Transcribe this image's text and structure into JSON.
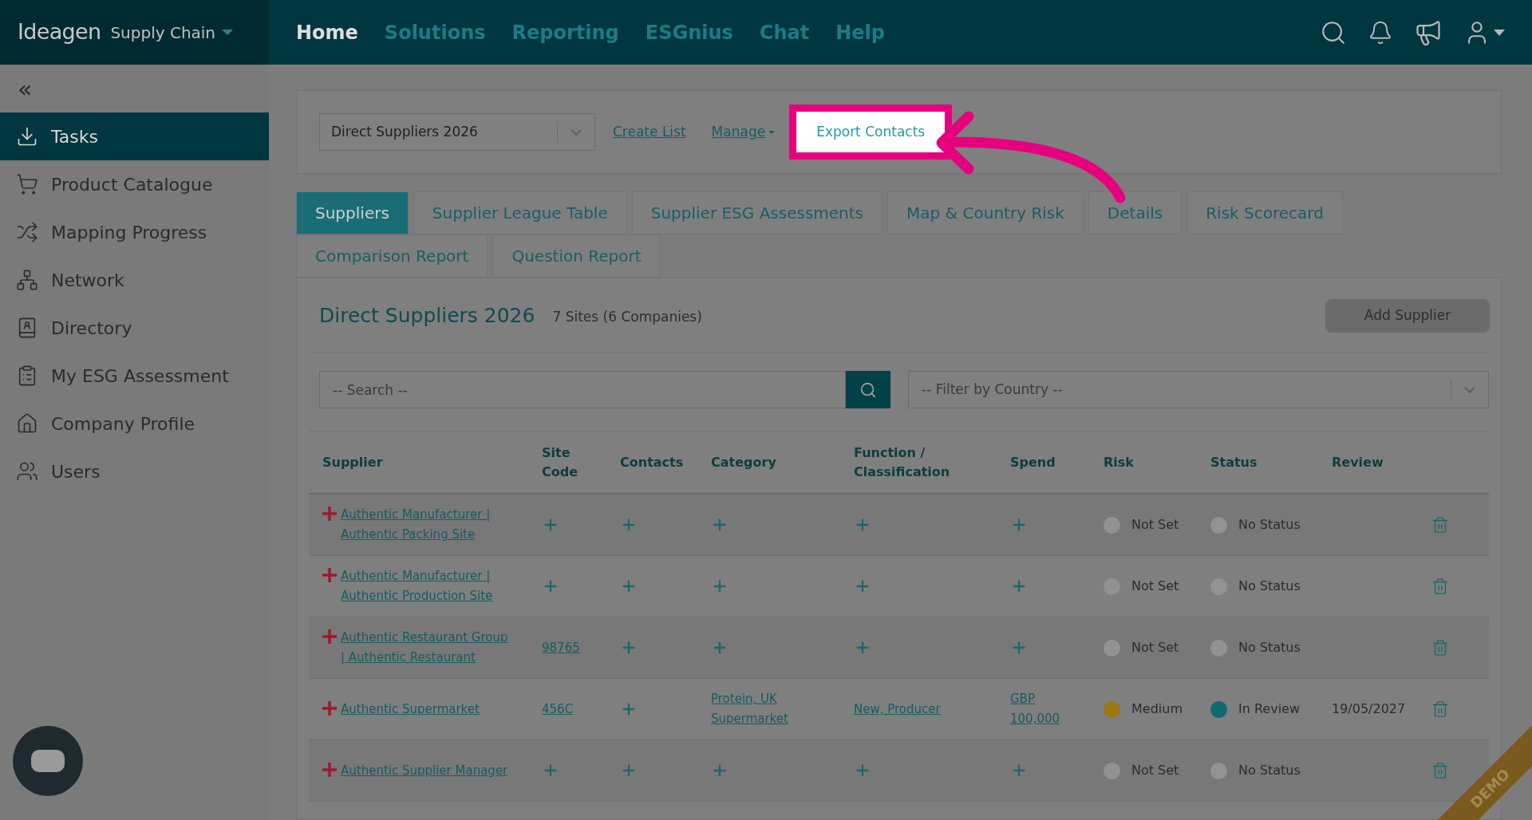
{
  "brand": {
    "name": "Ideagen",
    "product": "Supply Chain"
  },
  "nav": [
    {
      "label": "Home",
      "selected": true
    },
    {
      "label": "Solutions",
      "selected": false
    },
    {
      "label": "Reporting",
      "selected": false
    },
    {
      "label": "ESGnius",
      "selected": false
    },
    {
      "label": "Chat",
      "selected": false
    },
    {
      "label": "Help",
      "selected": false
    }
  ],
  "sidebar": {
    "collapse": "«",
    "items": [
      {
        "label": "Tasks",
        "selected": true
      },
      {
        "label": "Product Catalogue",
        "selected": false
      },
      {
        "label": "Mapping Progress",
        "selected": false
      },
      {
        "label": "Network",
        "selected": false
      },
      {
        "label": "Directory",
        "selected": false
      },
      {
        "label": "My ESG Assessment",
        "selected": false
      },
      {
        "label": "Company Profile",
        "selected": false
      },
      {
        "label": "Users",
        "selected": false
      }
    ]
  },
  "list_bar": {
    "list": "Direct Suppliers 2026",
    "links": [
      {
        "label": "Create List",
        "kind": "link"
      },
      {
        "label": "Manage",
        "kind": "menu"
      },
      {
        "label": "Export Contacts",
        "kind": "highlighted"
      }
    ]
  },
  "tabs": [
    [
      {
        "label": "Suppliers",
        "selected": true
      },
      {
        "label": "Supplier League Table",
        "selected": false
      },
      {
        "label": "Supplier ESG Assessments",
        "selected": false
      },
      {
        "label": "Map & Country Risk",
        "selected": false
      },
      {
        "label": "Details",
        "selected": false
      },
      {
        "label": "Risk Scorecard",
        "selected": false
      }
    ],
    [
      {
        "label": "Comparison Report",
        "selected": false
      },
      {
        "label": "Question Report",
        "selected": false
      }
    ]
  ],
  "panel": {
    "title": "Direct Suppliers 2026",
    "count": "7 Sites (6 Companies)",
    "add_button": "Add Supplier",
    "search_placeholder": "-- Search --",
    "country_placeholder": "-- Filter by Country --"
  },
  "table": {
    "columns": [
      "Supplier",
      "Site Code",
      "Contacts",
      "Category",
      "Function / Classification",
      "Spend",
      "Risk",
      "Status",
      "Review"
    ],
    "rows": [
      {
        "supplier": "Authentic Manufacturer | Authentic Packing Site",
        "risk": {
          "label": "Not Set",
          "color": "#929292"
        },
        "status": {
          "label": "No Status",
          "color": "#929292"
        }
      },
      {
        "supplier": "Authentic Manufacturer | Authentic Production Site",
        "risk": {
          "label": "Not Set",
          "color": "#929292"
        },
        "status": {
          "label": "No Status",
          "color": "#929292"
        }
      },
      {
        "supplier": "Authentic Restaurant Group | Authentic Restaurant",
        "site_code": "98765",
        "risk": {
          "label": "Not Set",
          "color": "#929292"
        },
        "status": {
          "label": "No Status",
          "color": "#929292"
        }
      },
      {
        "supplier": "Authentic Supermarket",
        "site_code": "456C",
        "category": "Protein, UK Supermarket",
        "function": "New, Producer",
        "spend": "GBP 100,000",
        "risk": {
          "label": "Medium",
          "color": "#9c7712"
        },
        "status": {
          "label": "In Review",
          "color": "#0e6a74"
        },
        "review": "19/05/2027"
      },
      {
        "supplier": "Authentic Supplier Manager",
        "risk": {
          "label": "Not Set",
          "color": "#929292"
        },
        "status": {
          "label": "No Status",
          "color": "#929292"
        }
      }
    ]
  },
  "ribbon": "DEMO"
}
